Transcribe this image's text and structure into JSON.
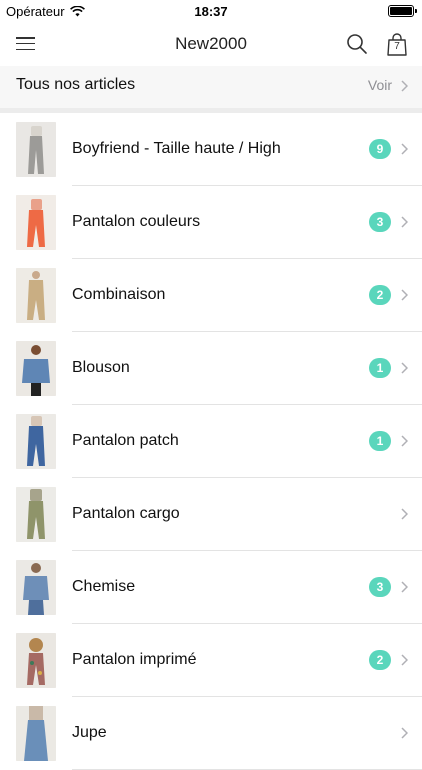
{
  "status_bar": {
    "carrier": "Opérateur",
    "time": "18:37",
    "battery_level": 1.0
  },
  "nav": {
    "title": "New2000",
    "cart_count": "7",
    "icons": [
      "menu-icon",
      "search-icon",
      "shopping-bag-icon"
    ]
  },
  "all_articles": {
    "label": "Tous nos articles",
    "action": "Voir"
  },
  "colors": {
    "badge": "#5ad6bc",
    "chevron": "#b0b0b5",
    "section_bg": "#f7f7f7"
  },
  "categories": [
    {
      "label": "Boyfriend - Taille haute / High",
      "count": "9"
    },
    {
      "label": "Pantalon couleurs",
      "count": "3"
    },
    {
      "label": "Combinaison",
      "count": "2"
    },
    {
      "label": "Blouson",
      "count": "1"
    },
    {
      "label": "Pantalon patch",
      "count": "1"
    },
    {
      "label": "Pantalon cargo",
      "count": ""
    },
    {
      "label": "Chemise",
      "count": "3"
    },
    {
      "label": "Pantalon imprimé",
      "count": "2"
    },
    {
      "label": "Jupe",
      "count": ""
    }
  ]
}
